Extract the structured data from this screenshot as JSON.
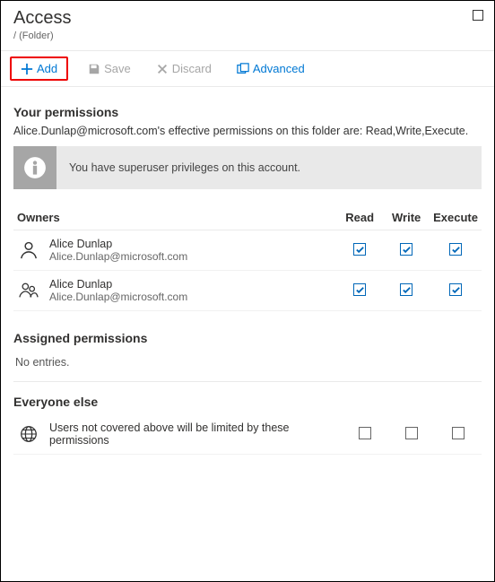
{
  "header": {
    "title": "Access",
    "path": "/ (Folder)"
  },
  "toolbar": {
    "add": "Add",
    "save": "Save",
    "discard": "Discard",
    "advanced": "Advanced"
  },
  "permissions": {
    "title": "Your permissions",
    "desc": "Alice.Dunlap@microsoft.com's effective permissions on this folder are: Read,Write,Execute.",
    "banner": "You have superuser privileges on this account."
  },
  "columns": {
    "read": "Read",
    "write": "Write",
    "execute": "Execute"
  },
  "owners": {
    "title": "Owners",
    "rows": [
      {
        "name": "Alice Dunlap",
        "email": "Alice.Dunlap@microsoft.com",
        "read": true,
        "write": true,
        "execute": true,
        "type": "user"
      },
      {
        "name": "Alice Dunlap",
        "email": "Alice.Dunlap@microsoft.com",
        "read": true,
        "write": true,
        "execute": true,
        "type": "group"
      }
    ]
  },
  "assigned": {
    "title": "Assigned permissions",
    "empty": "No entries."
  },
  "everyone": {
    "title": "Everyone else",
    "desc": "Users not covered above will be limited by these permissions",
    "read": false,
    "write": false,
    "execute": false
  }
}
